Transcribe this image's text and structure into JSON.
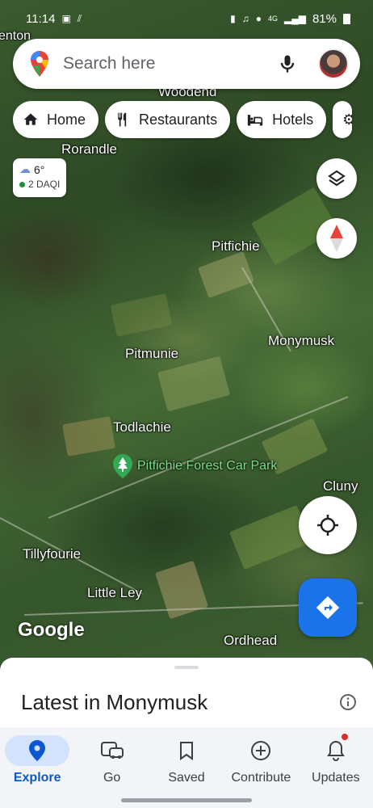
{
  "status_bar": {
    "time": "11:14",
    "network": "4G",
    "battery": "81%"
  },
  "search": {
    "placeholder": "Search here"
  },
  "chips": [
    {
      "label": "Home",
      "icon": "home-icon"
    },
    {
      "label": "Restaurants",
      "icon": "fork-knife-icon"
    },
    {
      "label": "Hotels",
      "icon": "bed-icon"
    }
  ],
  "weather": {
    "temp": "6°",
    "aqi": "2 DAQI",
    "icon": "sleet-cloud-icon"
  },
  "map": {
    "places": {
      "benton": "enton",
      "woodend": "Woodend",
      "rorandle": "Rorandle",
      "pitfichie": "Pitfichie",
      "monymusk": "Monymusk",
      "pitmunie": "Pitmunie",
      "todlachie": "Todlachie",
      "cluny": "Cluny",
      "tillyfourie": "Tillyfourie",
      "little_ley": "Little Ley",
      "ordhead": "Ordhead"
    },
    "poi": "Pitfichie Forest Car Park",
    "logo": "Google"
  },
  "sheet": {
    "title": "Latest in Monymusk"
  },
  "nav": [
    {
      "label": "Explore",
      "icon": "explore-pin-icon",
      "active": true
    },
    {
      "label": "Go",
      "icon": "car-bus-icon"
    },
    {
      "label": "Saved",
      "icon": "bookmark-icon"
    },
    {
      "label": "Contribute",
      "icon": "plus-circle-icon"
    },
    {
      "label": "Updates",
      "icon": "bell-icon"
    }
  ],
  "colors": {
    "accent": "#1a73e8",
    "nav_active": "#0b57d0",
    "nav_active_bg": "#d3e3fd",
    "poi_green": "#34a853"
  }
}
